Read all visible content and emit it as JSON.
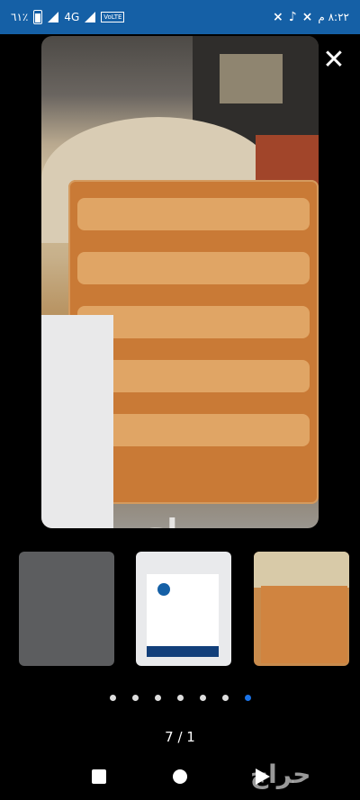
{
  "status_bar": {
    "battery_percent": "٦١٪",
    "network": "4G",
    "volte": "VoLTE",
    "time": "٨:٢٢ م"
  },
  "viewer": {
    "close_icon": "close-icon",
    "watermark": "حراج",
    "counter": "7 / 1",
    "total_images": 7,
    "active_dot_index": 6
  },
  "thumbnails": [
    {
      "name": "gravel-thumbnail"
    },
    {
      "name": "cement-bag-label-thumbnail"
    },
    {
      "name": "cement-bags-stack-thumbnail"
    }
  ],
  "nav_bar": {
    "watermark": "حراج"
  }
}
